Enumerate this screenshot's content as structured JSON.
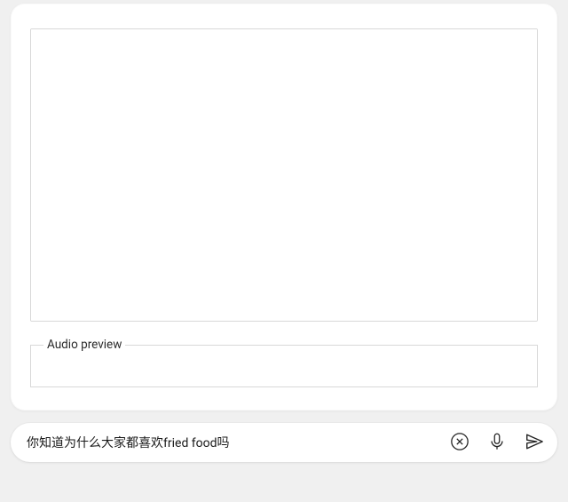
{
  "main": {
    "audio_preview_label": "Audio preview"
  },
  "input_bar": {
    "message_value": "你知道为什么大家都喜欢fried food吗",
    "message_placeholder": ""
  }
}
